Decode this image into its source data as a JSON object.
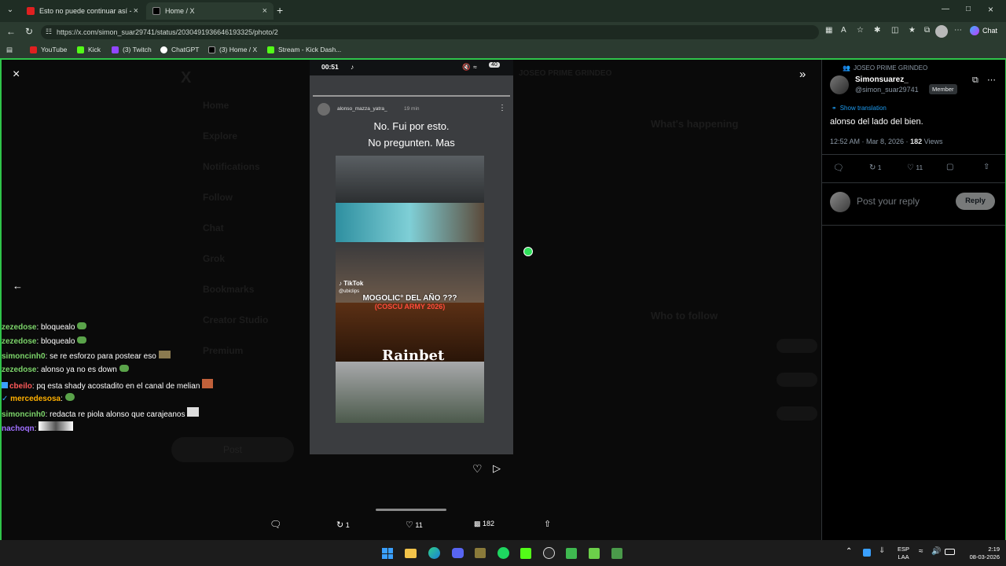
{
  "browser": {
    "tabs": [
      {
        "title": "Esto no puede continuar así - You",
        "color": "#e02020"
      },
      {
        "title": "Home / X",
        "color": "#000000"
      }
    ],
    "url": "https://x.com/simon_suar29741/status/2030491936646193325/photo/2",
    "chat_label": "Chat",
    "bookmarks": [
      {
        "label": "YouTube",
        "color": "#e02020"
      },
      {
        "label": "Kick",
        "color": "#53fc18"
      },
      {
        "label": "(3) Twitch",
        "color": "#9146ff"
      },
      {
        "label": "ChatGPT",
        "color": "#ffffff"
      },
      {
        "label": "(3) Home / X",
        "color": "#000000"
      },
      {
        "label": "Stream - Kick Dash...",
        "color": "#53fc18"
      }
    ]
  },
  "story": {
    "status_time": "00:51",
    "battery": "40",
    "username": "alonso_mazza_yatra_",
    "time_ago": "19 min",
    "caption_line1": "No.  Fui por esto.",
    "caption_line2": "No pregunten. Mas",
    "tiktok_label": "TikTok",
    "tiktok_handle": "@ubiclips",
    "overlay_line1": "MOGOLIC° DEL AÑO ???",
    "overlay_line2": "(COSCU ARMY 2026)",
    "sponsor": "Rainbet"
  },
  "actions": {
    "retweets": "1",
    "likes": "11",
    "views": "182"
  },
  "post": {
    "community": "JOSEO PRIME GRINDEO",
    "display_name": "Simonsuarez_",
    "handle": "@simon_suar29741",
    "role_badge": "Member",
    "show_translation": "Show translation",
    "text": "alonso del lado del bien.",
    "timestamp": "12:52 AM · Mar 8, 2026 ·",
    "views_count": "182",
    "views_label": "Views",
    "retweets": "1",
    "likes": "11",
    "reply_placeholder": "Post your reply",
    "reply_button": "Reply"
  },
  "chat_overlay": [
    {
      "user": "zezedose",
      "message": ": bloquealo",
      "color": "#7cd46a"
    },
    {
      "user": "zezedose",
      "message": ": bloquealo",
      "color": "#7cd46a"
    },
    {
      "user": "simoncinh0",
      "message": ": se re esforzo para postear eso",
      "color": "#7cd46a"
    },
    {
      "user": "zezedose",
      "message": ": alonso ya no es down",
      "color": "#7cd46a"
    },
    {
      "user": "cbeilo",
      "message": ": pq esta shady acostadito en el canal de melian",
      "color": "#ff5a5a"
    },
    {
      "user": "mercedesosa",
      "message": ":",
      "color": "#ffb000"
    },
    {
      "user": "simoncinh0",
      "message": ": redacta re piola alonso que carajeanos",
      "color": "#7cd46a"
    },
    {
      "user": "nachoqn",
      "message": ":",
      "color": "#a070ff"
    }
  ],
  "background_ghost": {
    "nav": [
      "Home",
      "Explore",
      "Notifications",
      "Follow",
      "Chat",
      "Grok",
      "Bookmarks",
      "Creator Studio",
      "Premium"
    ],
    "community_header": "JOSEO PRIME GRINDEO",
    "whats_happening": "What's happening",
    "who_to_follow": "Who to follow",
    "post_button": "Post"
  },
  "taskbar": {
    "lang_line1": "ESP",
    "lang_line2": "LAA",
    "time": "2:19",
    "date": "08-03-2026"
  }
}
